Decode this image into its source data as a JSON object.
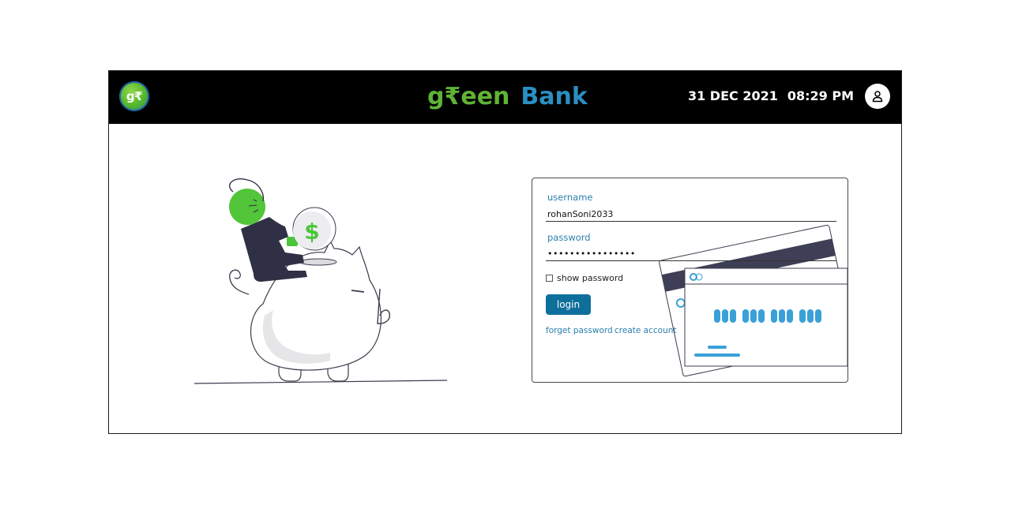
{
  "header": {
    "logo_badge_text": "g₹",
    "brand_part1": "g₹een",
    "brand_part2": "Bank",
    "date": "31 DEC 2021",
    "time": "08:29 PM",
    "avatar_icon": "user-icon"
  },
  "login": {
    "username_label": "username",
    "username_value": "rohanSoni2033",
    "password_label": "password",
    "password_value": "••••••••••••••••",
    "show_password_label": "show password",
    "show_password_checked": false,
    "login_button": "login",
    "forget_password_link": "forget password",
    "create_account_link": "create account"
  },
  "illustration": {
    "coin_symbol": "$"
  },
  "colors": {
    "brand_green": "#5fb336",
    "brand_blue": "#2a8fc2",
    "accent": "#0f6f9c",
    "topbar": "#000000"
  }
}
